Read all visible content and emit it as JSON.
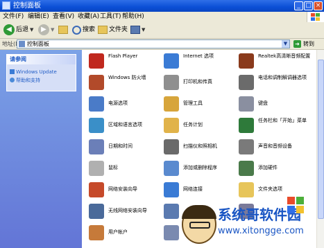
{
  "window": {
    "title": "控制面板"
  },
  "titlebar_buttons": [
    "_",
    "□",
    "×"
  ],
  "menu": [
    "文件(F)",
    "编辑(E)",
    "查看(V)",
    "收藏(A)",
    "工具(T)",
    "帮助(H)"
  ],
  "toolbar": {
    "back_label": "后退",
    "search_label": "搜索",
    "folders_label": "文件夹"
  },
  "address": {
    "label": "地址(D)",
    "value": "控制面板",
    "go_label": "转到"
  },
  "side_panel": {
    "header": "请参阅",
    "links": [
      "Windows Update",
      "帮助和支持"
    ]
  },
  "items": [
    {
      "label": "Flash Player",
      "color": "#c0281e"
    },
    {
      "label": "Internet 选项",
      "color": "#3a7bd5"
    },
    {
      "label": "Realtek高清晰音频配置",
      "color": "#8a3a1c"
    },
    {
      "label": "Windows 防火墙",
      "color": "#b24a2a"
    },
    {
      "label": "打印机和传真",
      "color": "#8f8f8f"
    },
    {
      "label": "电话和调制解调器选项",
      "color": "#6b6b6b"
    },
    {
      "label": "电源选项",
      "color": "#4a7bc8"
    },
    {
      "label": "管理工具",
      "color": "#d7a53b"
    },
    {
      "label": "键盘",
      "color": "#8a8fa0"
    },
    {
      "label": "区域和语言选项",
      "color": "#3a8fc8"
    },
    {
      "label": "任务计划",
      "color": "#e1b34a"
    },
    {
      "label": "任务栏和「开始」菜单",
      "color": "#2e7a3a"
    },
    {
      "label": "日期和时间",
      "color": "#6b7fb8"
    },
    {
      "label": "扫描仪和照相机",
      "color": "#6a6a6a"
    },
    {
      "label": "声音和音频设备",
      "color": "#7a7a7a"
    },
    {
      "label": "鼠标",
      "color": "#b0b0b0"
    },
    {
      "label": "添加或删除程序",
      "color": "#5a8acf"
    },
    {
      "label": "添加硬件",
      "color": "#4a7a4a"
    },
    {
      "label": "网络安装向导",
      "color": "#c64a2a"
    },
    {
      "label": "网络连接",
      "color": "#3a7bd5"
    },
    {
      "label": "文件夹选项",
      "color": "#e7c55a"
    },
    {
      "label": "无线网络安装向导",
      "color": "#4a6a9a"
    },
    {
      "label": "",
      "color": "#5a7ab0"
    },
    {
      "label": "",
      "color": "#7a7a9a"
    },
    {
      "label": "用户帐户",
      "color": "#c67a3a"
    },
    {
      "label": "",
      "color": "#7a8ab0"
    }
  ],
  "watermark": {
    "title": "系统哥软件园",
    "url": "www.xitongge.com"
  }
}
